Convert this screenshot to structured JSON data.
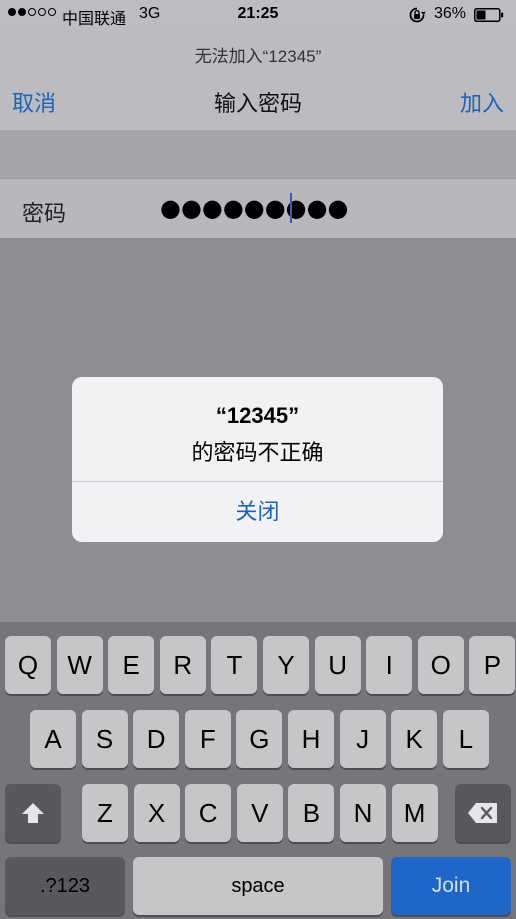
{
  "status_bar": {
    "carrier": "中国联通",
    "network": "3G",
    "time": "21:25",
    "battery_percent": "36%"
  },
  "nav": {
    "prompt": "无法加入“12345”",
    "cancel_label": "取消",
    "title": "输入密码",
    "join_label": "加入"
  },
  "password_row": {
    "label": "密码",
    "masked_value": "●●●●●●●●●"
  },
  "alert": {
    "title": "“12345”",
    "message": "的密码不正确",
    "button_label": "关闭"
  },
  "keyboard": {
    "row1": [
      "Q",
      "W",
      "E",
      "R",
      "T",
      "Y",
      "U",
      "I",
      "O",
      "P"
    ],
    "row2": [
      "A",
      "S",
      "D",
      "F",
      "G",
      "H",
      "J",
      "K",
      "L"
    ],
    "row3": [
      "Z",
      "X",
      "C",
      "V",
      "B",
      "N",
      "M"
    ],
    "numbers_label": ".?123",
    "space_label": "space",
    "join_label": "Join",
    "shift_icon": "shift-arrow-icon",
    "delete_icon": "backspace-icon"
  },
  "colors": {
    "accent": "#1f63b5",
    "join_key": "#1e66c8"
  }
}
